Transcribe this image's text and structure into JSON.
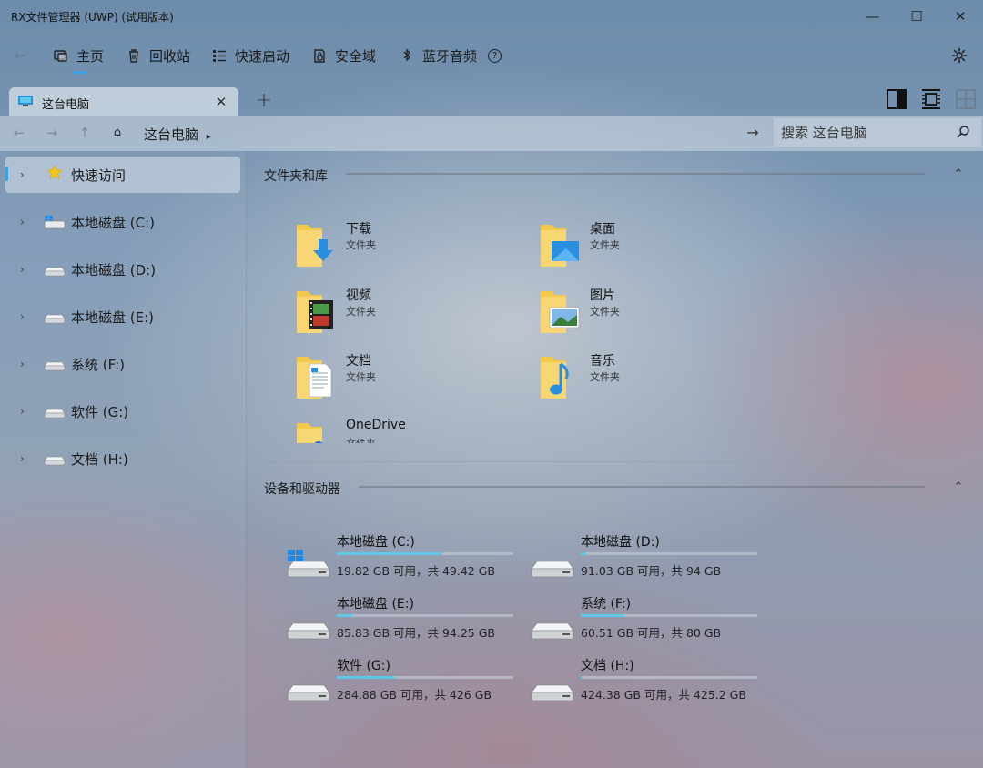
{
  "window": {
    "title": "RX文件管理器 (UWP) (试用版本)",
    "minimize": "—",
    "maximize": "☐",
    "close": "✕"
  },
  "toolbar": {
    "back": "←",
    "items": [
      {
        "label": "主页",
        "icon": "home-icon"
      },
      {
        "label": "回收站",
        "icon": "recycle-bin-icon"
      },
      {
        "label": "快速启动",
        "icon": "quick-launch-icon"
      },
      {
        "label": "安全域",
        "icon": "secure-area-icon"
      },
      {
        "label": "蓝牙音频",
        "icon": "bluetooth-icon"
      }
    ],
    "help": "?",
    "settings_icon": "gear-icon",
    "accent": "#3aa3e6"
  },
  "tabs": {
    "items": [
      {
        "label": "这台电脑",
        "icon": "computer-icon"
      }
    ],
    "close": "✕",
    "add": "+"
  },
  "addressbar": {
    "back": "←",
    "forward": "→",
    "up": "↑",
    "home": "⌂",
    "crumb": "这台电脑",
    "crumb_sep": "▸",
    "go": "→",
    "search_placeholder": "搜索 这台电脑"
  },
  "sidebar": {
    "items": [
      {
        "label": "快速访问",
        "icon": "star-icon",
        "chevron": "›",
        "selected": true
      },
      {
        "label": "本地磁盘 (C:)",
        "icon": "windows-drive-icon",
        "chevron": "›"
      },
      {
        "label": "本地磁盘 (D:)",
        "icon": "drive-icon",
        "chevron": "›"
      },
      {
        "label": "本地磁盘 (E:)",
        "icon": "drive-icon",
        "chevron": "›"
      },
      {
        "label": "系统 (F:)",
        "icon": "drive-icon",
        "chevron": "›"
      },
      {
        "label": "软件 (G:)",
        "icon": "drive-icon",
        "chevron": "›"
      },
      {
        "label": "文档 (H:)",
        "icon": "drive-icon",
        "chevron": "›"
      }
    ]
  },
  "sections": {
    "folders": {
      "title": "文件夹和库",
      "chevron": "⌃"
    },
    "drives": {
      "title": "设备和驱动器",
      "chevron": "⌃"
    }
  },
  "folders": [
    {
      "name": "下载",
      "type": "文件夹",
      "icon": "downloads-folder-icon"
    },
    {
      "name": "桌面",
      "type": "文件夹",
      "icon": "desktop-folder-icon"
    },
    {
      "name": "视频",
      "type": "文件夹",
      "icon": "videos-folder-icon"
    },
    {
      "name": "图片",
      "type": "文件夹",
      "icon": "pictures-folder-icon"
    },
    {
      "name": "文档",
      "type": "文件夹",
      "icon": "documents-folder-icon"
    },
    {
      "name": "音乐",
      "type": "文件夹",
      "icon": "music-folder-icon"
    },
    {
      "name": "OneDrive",
      "type": "文件夹",
      "icon": "onedrive-folder-icon"
    }
  ],
  "drives": [
    {
      "name": "本地磁盘 (C:)",
      "free": "19.82 GB 可用，共 49.42 GB",
      "used_fraction": 0.6,
      "icon": "windows-drive-icon"
    },
    {
      "name": "本地磁盘 (D:)",
      "free": "91.03 GB 可用，共 94 GB",
      "used_fraction": 0.03,
      "icon": "drive-icon"
    },
    {
      "name": "本地磁盘 (E:)",
      "free": "85.83 GB 可用，共 94.25 GB",
      "used_fraction": 0.09,
      "icon": "drive-icon"
    },
    {
      "name": "系统 (F:)",
      "free": "60.51 GB 可用，共 80 GB",
      "used_fraction": 0.24,
      "icon": "drive-icon"
    },
    {
      "name": "软件 (G:)",
      "free": "284.88 GB 可用，共 426 GB",
      "used_fraction": 0.33,
      "icon": "drive-icon"
    },
    {
      "name": "文档 (H:)",
      "free": "424.38 GB 可用，共 425.2 GB",
      "used_fraction": 0.01,
      "icon": "drive-icon"
    }
  ],
  "colors": {
    "accent": "#3aa3e6",
    "folder_yellow": "#f2c94c",
    "drive_bar": "#5ec8e6"
  }
}
